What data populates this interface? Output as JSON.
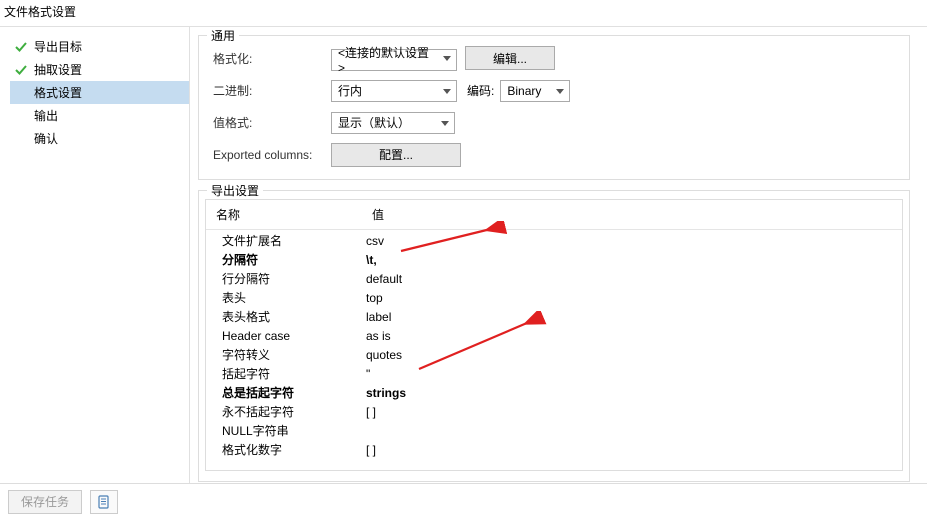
{
  "window": {
    "title": "文件格式设置"
  },
  "sidebar": {
    "items": [
      {
        "label": "导出目标",
        "completed": true,
        "selected": false
      },
      {
        "label": "抽取设置",
        "completed": true,
        "selected": false
      },
      {
        "label": "格式设置",
        "completed": false,
        "selected": true
      },
      {
        "label": "输出",
        "completed": false,
        "selected": false
      },
      {
        "label": "确认",
        "completed": false,
        "selected": false
      }
    ]
  },
  "general": {
    "legend": "通用",
    "formatLabel": "格式化:",
    "formatSelected": "<连接的默认设置>",
    "editBtn": "编辑...",
    "binaryLabel": "二进制:",
    "binarySelected": "行内",
    "encodingLabel": "编码:",
    "encodingSelected": "Binary",
    "valueFormatLabel": "值格式:",
    "valueFormatSelected": "显示（默认）",
    "exportedColumnsLabel": "Exported columns:",
    "configureBtn": "配置..."
  },
  "export": {
    "legend": "导出设置",
    "headerName": "名称",
    "headerValue": "值",
    "rows": [
      {
        "name": "文件扩展名",
        "value": "csv",
        "bold": false
      },
      {
        "name": "分隔符",
        "value": "\\t,",
        "bold": true
      },
      {
        "name": "行分隔符",
        "value": "default",
        "bold": false
      },
      {
        "name": "表头",
        "value": "top",
        "bold": false
      },
      {
        "name": "表头格式",
        "value": "label",
        "bold": false
      },
      {
        "name": "Header case",
        "value": "as is",
        "bold": false
      },
      {
        "name": "字符转义",
        "value": "quotes",
        "bold": false
      },
      {
        "name": "括起字符",
        "value": "\"",
        "bold": false
      },
      {
        "name": "总是括起字符",
        "value": "strings",
        "bold": true
      },
      {
        "name": "永不括起字符",
        "value": "[ ]",
        "bold": false
      },
      {
        "name": "NULL字符串",
        "value": "",
        "bold": false
      },
      {
        "name": "格式化数字",
        "value": "[ ]",
        "bold": false
      }
    ]
  },
  "footer": {
    "saveTaskBtn": "保存任务"
  }
}
